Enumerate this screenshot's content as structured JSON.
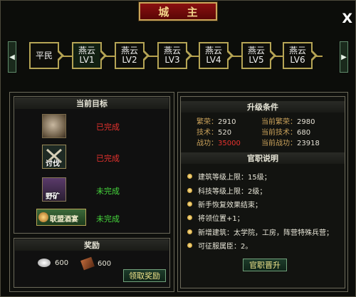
{
  "window": {
    "title": "城 主"
  },
  "ranks": [
    {
      "line1": "平民",
      "line2": ""
    },
    {
      "line1": "燕云",
      "line2": "LV1"
    },
    {
      "line1": "燕云",
      "line2": "LV2"
    },
    {
      "line1": "燕云",
      "line2": "LV3"
    },
    {
      "line1": "燕云",
      "line2": "LV4"
    },
    {
      "line1": "燕云",
      "line2": "LV5"
    },
    {
      "line1": "燕云",
      "line2": "LV6"
    }
  ],
  "goals": {
    "title": "当前目标",
    "items": [
      {
        "status": "已完成",
        "icon_text": ""
      },
      {
        "status": "已完成",
        "icon_text": "讨伐"
      },
      {
        "status": "未完成",
        "icon_text": "野矿"
      },
      {
        "status": "未完成",
        "icon_text": "联盟酒宴"
      }
    ]
  },
  "rewards": {
    "title": "奖励",
    "items": [
      {
        "value": "600"
      },
      {
        "value": "600"
      }
    ],
    "claim_button": "领取奖励"
  },
  "upgrade": {
    "title": "升级条件",
    "stats": [
      {
        "label": "繁荣：",
        "value": "2910"
      },
      {
        "label": "当前繁荣：",
        "value": "2980"
      },
      {
        "label": "技术：",
        "value": "520"
      },
      {
        "label": "当前技术：",
        "value": "680"
      },
      {
        "label": "战功：",
        "value": "35000"
      },
      {
        "label": "当前战功：",
        "value": "23918"
      }
    ]
  },
  "rank_desc": {
    "title": "官职说明",
    "items": [
      "建筑等级上限：15级；",
      "科技等级上限：2级；",
      "新手恢复效果结束；",
      "将领位置+1；",
      "新增建筑：太学院，工房，阵营特殊兵营；",
      "可征服属臣：2。"
    ],
    "promote_button": "官职晋升"
  },
  "colors": {
    "done": "#e8322e",
    "not_done": "#46d83c",
    "label_gold": "#c9a15a"
  }
}
